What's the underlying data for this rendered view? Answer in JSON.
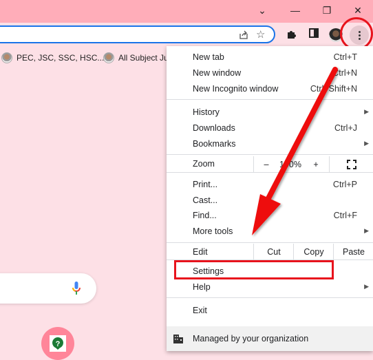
{
  "window": {
    "controls": {
      "tab_search": "⌄",
      "minimize": "—",
      "restore": "❐",
      "close": "✕"
    }
  },
  "toolbar": {
    "share_icon": "share-icon",
    "bookmark_star_icon": "star-icon",
    "extensions_icon": "puzzle-icon",
    "side_panel_icon": "side-panel-icon",
    "profile_icon": "avatar",
    "menu_icon": "three-dots-vertical-icon"
  },
  "bookmarks": [
    {
      "label": "PEC, JSC, SSC, HSC..."
    },
    {
      "label": "All Subject Ju"
    }
  ],
  "menu": {
    "items": [
      {
        "label": "New tab",
        "shortcut": "Ctrl+T"
      },
      {
        "label": "New window",
        "shortcut": "Ctrl+N"
      },
      {
        "label": "New Incognito window",
        "shortcut": "Ctrl+Shift+N"
      },
      {
        "label": "History",
        "submenu": true
      },
      {
        "label": "Downloads",
        "shortcut": "Ctrl+J"
      },
      {
        "label": "Bookmarks",
        "submenu": true
      },
      {
        "label": "Print...",
        "shortcut": "Ctrl+P"
      },
      {
        "label": "Cast..."
      },
      {
        "label": "Find...",
        "shortcut": "Ctrl+F"
      },
      {
        "label": "More tools",
        "submenu": true
      },
      {
        "label": "Settings"
      },
      {
        "label": "Help",
        "submenu": true
      },
      {
        "label": "Exit"
      }
    ],
    "zoom": {
      "label": "Zoom",
      "minus": "–",
      "value": "100%",
      "plus": "+"
    },
    "edit": {
      "label": "Edit",
      "cut": "Cut",
      "copy": "Copy",
      "paste": "Paste"
    },
    "managed": {
      "label": "Managed by your organization"
    },
    "submenu_arrow": "▶"
  },
  "annotations": {
    "highlight_color": "#e8131c",
    "highlighted_item": "Settings"
  },
  "colors": {
    "titlebar": "#ffadb9",
    "page_bg": "#fde0e6",
    "omnibox_border": "#1a73e8"
  }
}
